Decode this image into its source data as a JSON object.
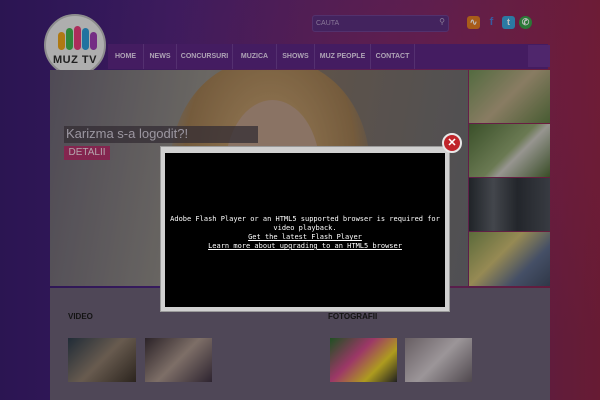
{
  "header": {
    "logo_text": "MUZ TV",
    "search_placeholder": "CAUTA",
    "social_icons": [
      "rss-icon",
      "facebook-icon",
      "twitter-icon",
      "phone-icon"
    ]
  },
  "nav": {
    "items": [
      {
        "label": "HOME"
      },
      {
        "label": "NEWS"
      },
      {
        "label": "CONCURSURI"
      },
      {
        "label": "MUZICA"
      },
      {
        "label": "SHOWS"
      },
      {
        "label": "MUZ PEOPLE"
      },
      {
        "label": "CONTACT"
      }
    ]
  },
  "slider": {
    "caption": "Karizma s-a logodit?!",
    "details_label": "DETALII"
  },
  "sections": {
    "video_title": "VIDEO",
    "photos_title": "FOTOGRAFII"
  },
  "flash_modal": {
    "message": "Adobe Flash Player or an HTML5 supported browser is required for video playback.",
    "link_flash": "Get the latest Flash Player",
    "link_html5": "Learn more about upgrading to an HTML5 browser",
    "close_symbol": "✕"
  },
  "colors": {
    "accent": "#b0326a",
    "nav_bg": "#5b2682",
    "close_button": "#c0242a"
  }
}
